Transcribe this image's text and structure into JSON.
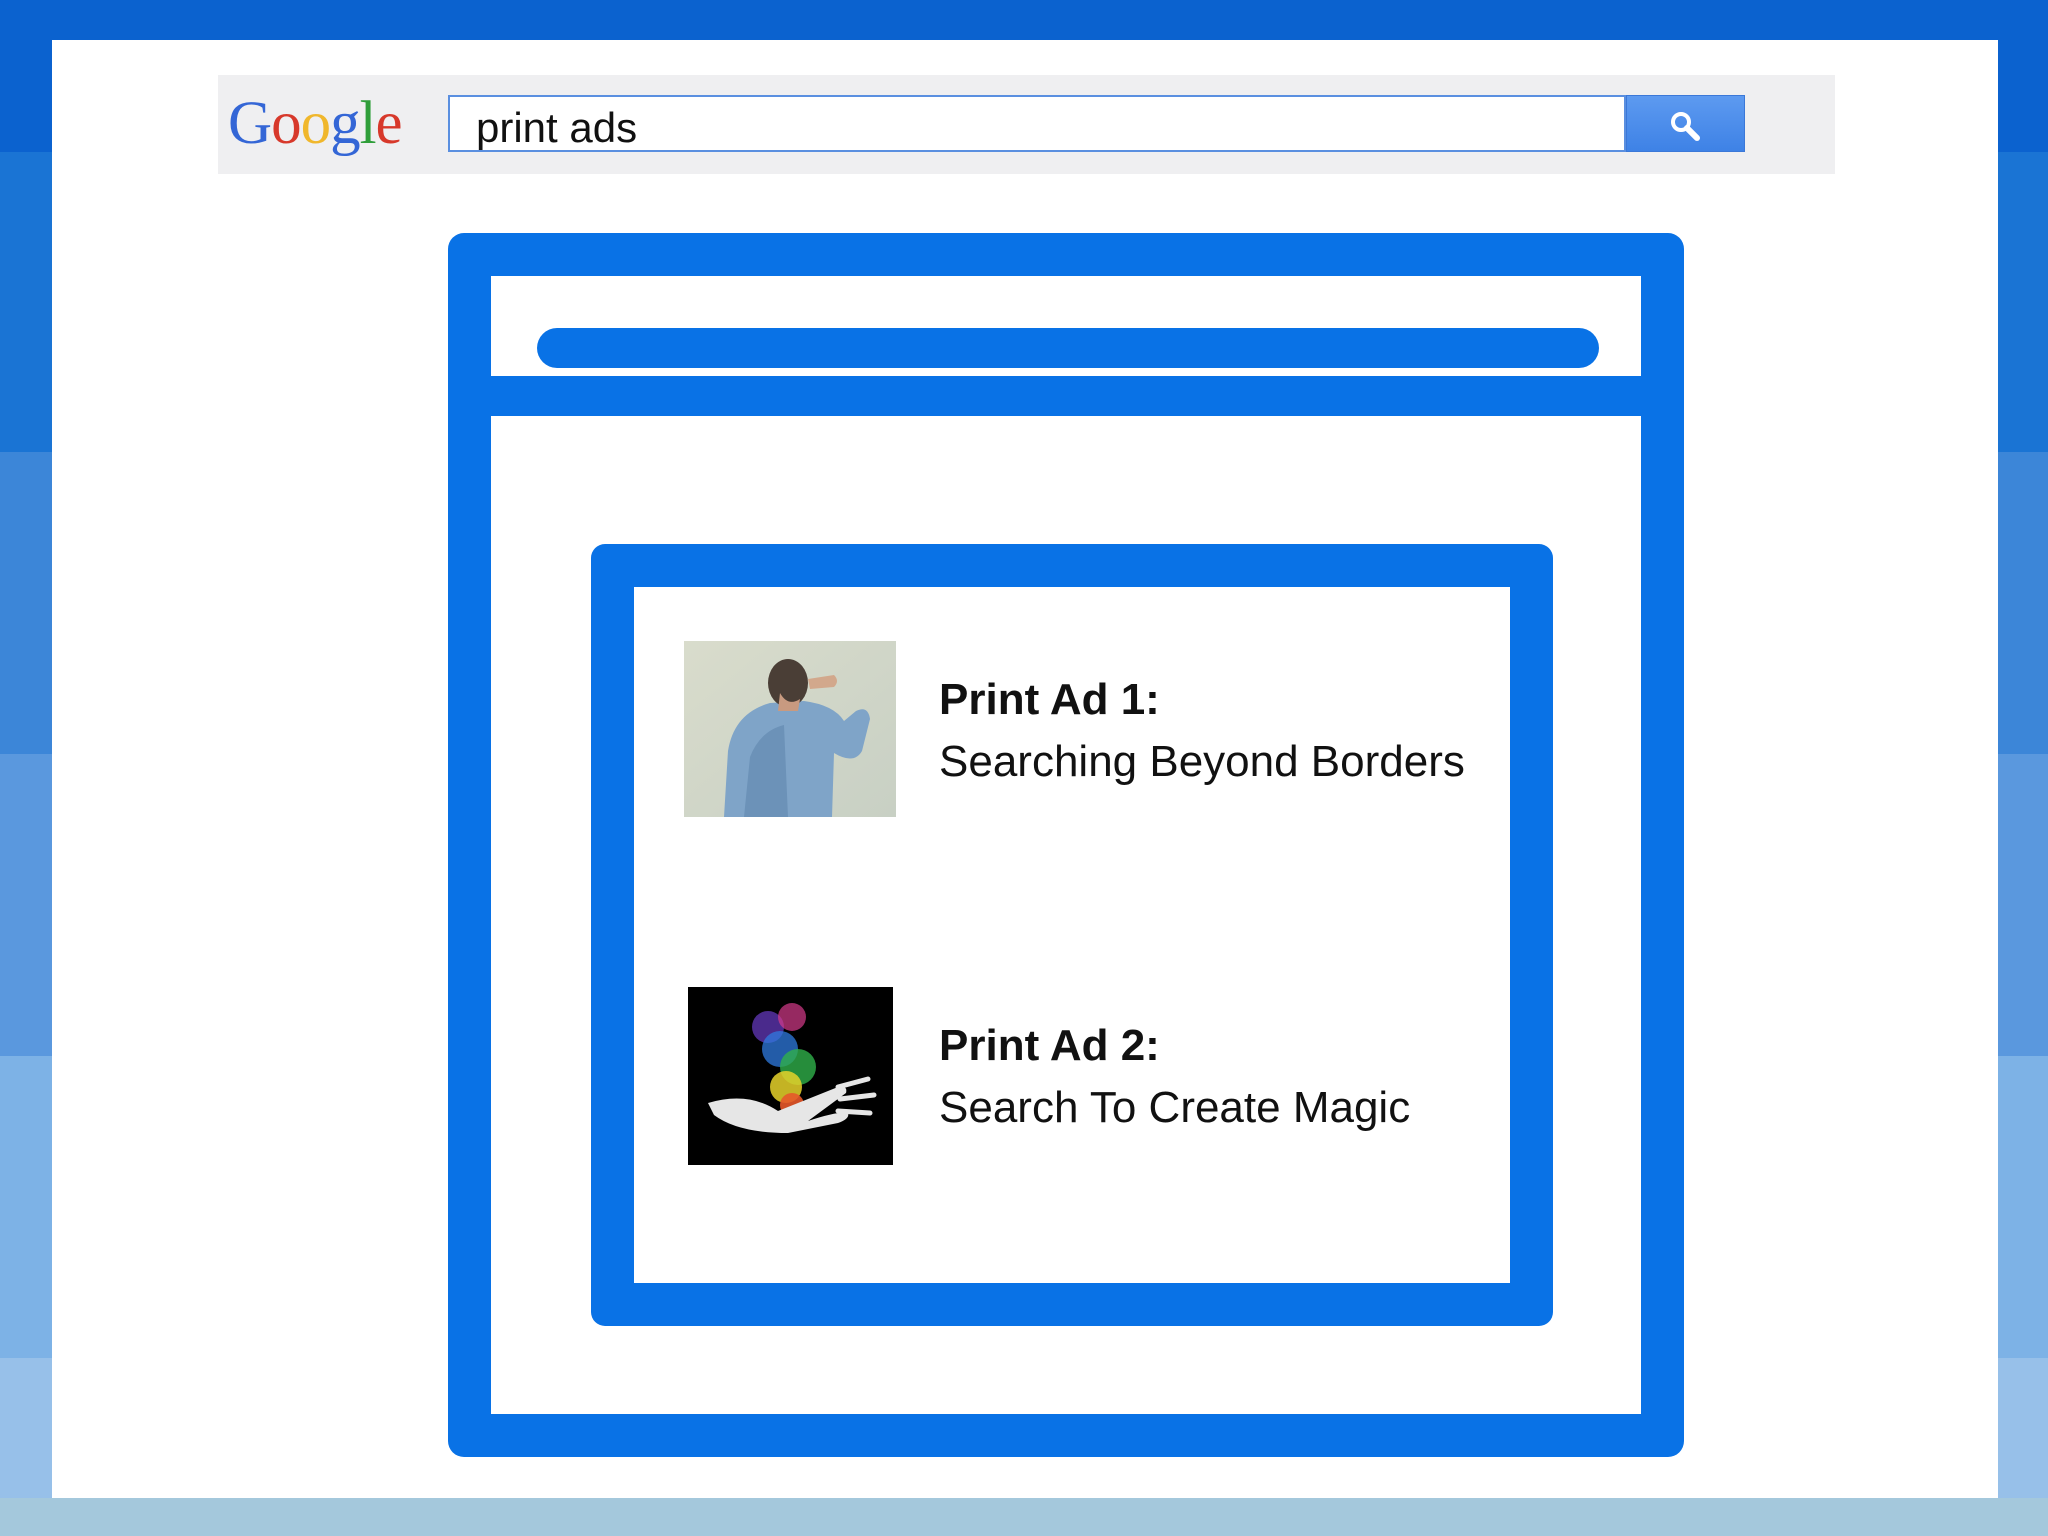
{
  "search": {
    "logo_letters": [
      {
        "char": "G",
        "color": "#3466d6"
      },
      {
        "char": "o",
        "color": "#d7382b"
      },
      {
        "char": "o",
        "color": "#f0b72c"
      },
      {
        "char": "g",
        "color": "#3466d6"
      },
      {
        "char": "l",
        "color": "#2f9e3a"
      },
      {
        "char": "e",
        "color": "#d7382b"
      }
    ],
    "query": "print ads",
    "button_icon": "search-icon"
  },
  "colors": {
    "accent": "#0972e6",
    "background": "#0b62cf",
    "search_button": "#4a8af4"
  },
  "ads": [
    {
      "title": "Print Ad 1:",
      "subtitle": "Searching Beyond Borders",
      "image": "man-looking-into-distance"
    },
    {
      "title": "Print Ad 2:",
      "subtitle": "Search To Create Magic",
      "image": "hand-releasing-colorful-smoke"
    }
  ]
}
